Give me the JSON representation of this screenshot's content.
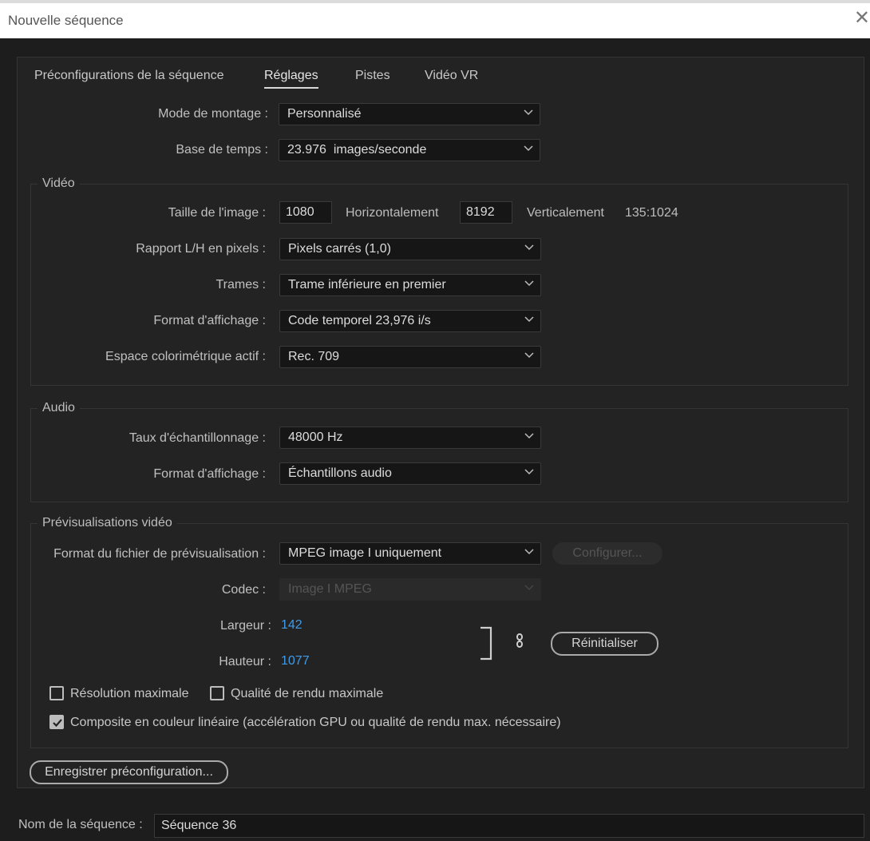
{
  "window": {
    "title": "Nouvelle séquence",
    "close": "✕"
  },
  "tabs": [
    "Préconfigurations de la séquence",
    "Réglages",
    "Pistes",
    "Vidéo VR"
  ],
  "general": {
    "edit_mode_label": "Mode de montage :",
    "edit_mode_value": "Personnalisé",
    "timebase_label": "Base de temps :",
    "timebase_value": "23.976  images/seconde"
  },
  "video": {
    "title": "Vidéo",
    "frame_size_label": "Taille de l'image :",
    "frame_width": "1080",
    "horizontal_label": "Horizontalement",
    "frame_height": "8192",
    "vertical_label": "Verticalement",
    "aspect": "135:1024",
    "pixel_aspect_label": "Rapport L/H en pixels :",
    "pixel_aspect_value": "Pixels carrés (1,0)",
    "fields_label": "Trames :",
    "fields_value": "Trame inférieure en premier",
    "display_format_label": "Format d'affichage :",
    "display_format_value": "Code temporel 23,976 i/s",
    "color_space_label": "Espace colorimétrique actif :",
    "color_space_value": "Rec. 709"
  },
  "audio": {
    "title": "Audio",
    "sample_rate_label": "Taux d'échantillonnage :",
    "sample_rate_value": "48000 Hz",
    "display_format_label": "Format d'affichage :",
    "display_format_value": "Échantillons audio"
  },
  "previews": {
    "title": "Prévisualisations vidéo",
    "file_format_label": "Format du fichier de prévisualisation :",
    "file_format_value": "MPEG image I uniquement",
    "configure_button": "Configurer...",
    "codec_label": "Codec :",
    "codec_value": "Image I MPEG",
    "width_label": "Largeur :",
    "width_value": "142",
    "height_label": "Hauteur :",
    "height_value": "1077",
    "reset_button": "Réinitialiser",
    "max_bit_depth_label": "Résolution maximale",
    "max_render_quality_label": "Qualité de rendu maximale",
    "linear_color_label": "Composite en couleur linéaire (accélération GPU ou qualité de rendu max. nécessaire)",
    "max_bit_depth_checked": false,
    "max_render_quality_checked": false,
    "linear_color_checked": true
  },
  "save_preset_button": "Enregistrer préconfiguration...",
  "sequence_name_label": "Nom de la séquence :",
  "sequence_name_value": "Séquence 36"
}
